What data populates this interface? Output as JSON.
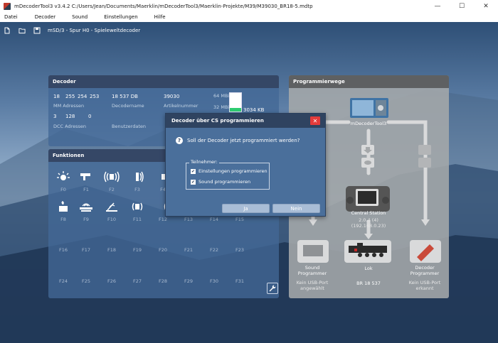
{
  "window": {
    "title": "mDecoderTool3  v3.4.2    C:/Users/Jean/Documents/Maerklin/mDecoderTool3/Maerklin-Projekte/M39/M39030_BR18-5.mdtp",
    "minimize": "—",
    "maximize": "☐",
    "close": "✕"
  },
  "menu": [
    "Datei",
    "Decoder",
    "Sound",
    "Einstellungen",
    "Hilfe"
  ],
  "toolbar": {
    "decoder_type": "mSD/3 - Spur H0 - Spielewelt­decoder"
  },
  "decoder_panel": {
    "title": "Decoder",
    "mm_addresses": [
      "18",
      "255",
      "254",
      "253"
    ],
    "mm_label": "MM Adressen",
    "decoder_name": "18 537 DB",
    "decoder_name_label": "Decodername",
    "article_number": "39030",
    "article_label": "Artikelnummer",
    "dcc_address_values": [
      "3",
      "128",
      "0"
    ],
    "dcc_label": "DCC Adressen",
    "user_data_label": "Benutzerdaten",
    "mem_64": "64 MBit",
    "mem_32": "32 MBit",
    "mem_used": "3034 KB",
    "mem_fill_fraction": 0.18
  },
  "functions_panel": {
    "title": "Funktionen",
    "rows": [
      [
        "F0",
        "F1",
        "F2",
        "F3",
        "F4",
        "",
        "",
        ""
      ],
      [
        "F8",
        "F9",
        "F10",
        "F11",
        "F12",
        "F13",
        "F14",
        "F15"
      ],
      [
        "F16",
        "F17",
        "F18",
        "F19",
        "F20",
        "F21",
        "F22",
        "F23"
      ],
      [
        "F24",
        "F25",
        "F26",
        "F27",
        "F28",
        "F29",
        "F30",
        "F31"
      ]
    ],
    "icons_row0": [
      "light-icon",
      "horn-icon",
      "sound-icon",
      "bell-icon",
      "sound-icon"
    ],
    "icons_row1": [
      "smoke-icon",
      "coupler-icon",
      "crane-icon",
      "sound-icon",
      "sound-icon"
    ]
  },
  "prog_panel": {
    "title": "Programmierwege",
    "top_device": "mDecoderTool3",
    "central_station": "Central Station",
    "cs_version": "2.0.4 (4)",
    "cs_ip": "(192.168.0.23)",
    "sound_programmer": "Sound\nProgrammer",
    "sound_programmer_status": "Kein USB-Port\nangewählt",
    "lok": "Lok",
    "lok_name": "BR 18 537",
    "decoder_programmer": "Decoder\nProgrammer",
    "decoder_programmer_status": "Kein USB-Port\nerkannt"
  },
  "dialog": {
    "title": "Decoder über CS programmieren",
    "question": "Soll der Decoder jetzt programmiert werden?",
    "group_title": "Teilnehmer:",
    "check1": "Einstellungen programmieren",
    "check2": "Sound programmieren",
    "yes": "Ja",
    "no": "Nein"
  }
}
